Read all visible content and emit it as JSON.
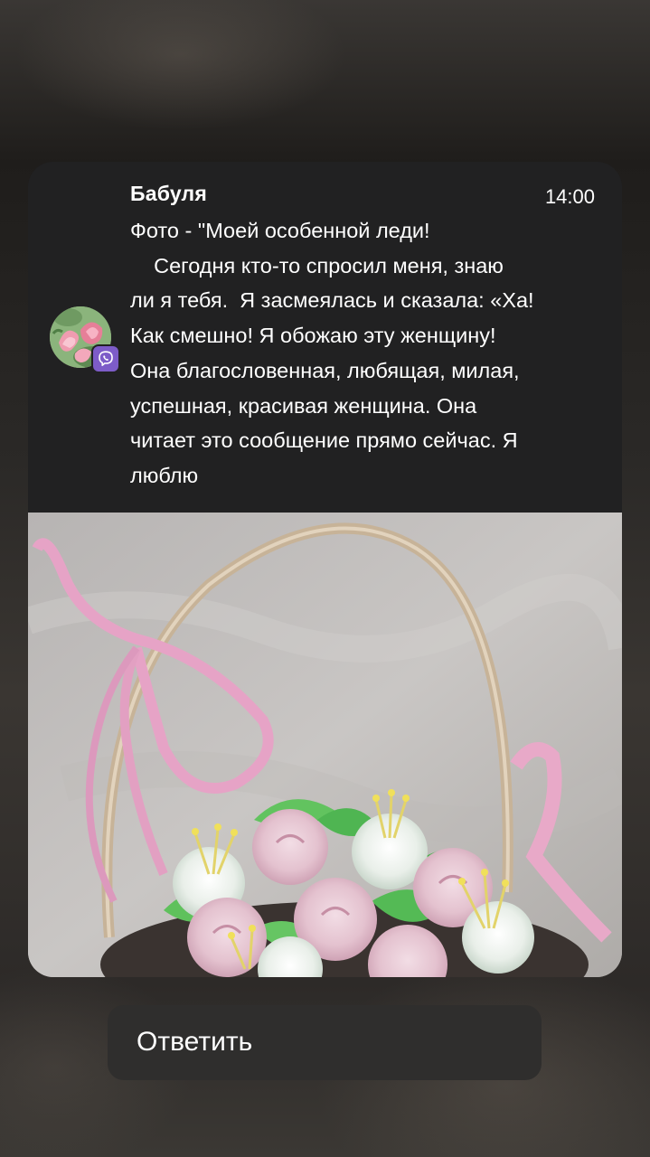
{
  "notification": {
    "sender": "Бабуля",
    "time": "14:00",
    "message": "Фото - \"Моей особенной леди!\n    Сегодня кто-то спросил меня, знаю\nли я тебя.  Я засмеялась и сказала: «Ха!\nКак смешно! Я обожаю эту женщину!\nОна благословенная, любящая, милая,\nуспешная, красивая женщина. Она\nчитает это сообщение прямо сейчас. Я\nлюблю",
    "app_icon": "viber-icon",
    "avatar_icon": "tulips-avatar"
  },
  "actions": {
    "reply_label": "Ответить"
  },
  "colors": {
    "card_background": "#212122",
    "app_badge": "#7d5cc8",
    "reply_background": "#2f2e2d",
    "text": "#ffffff"
  }
}
